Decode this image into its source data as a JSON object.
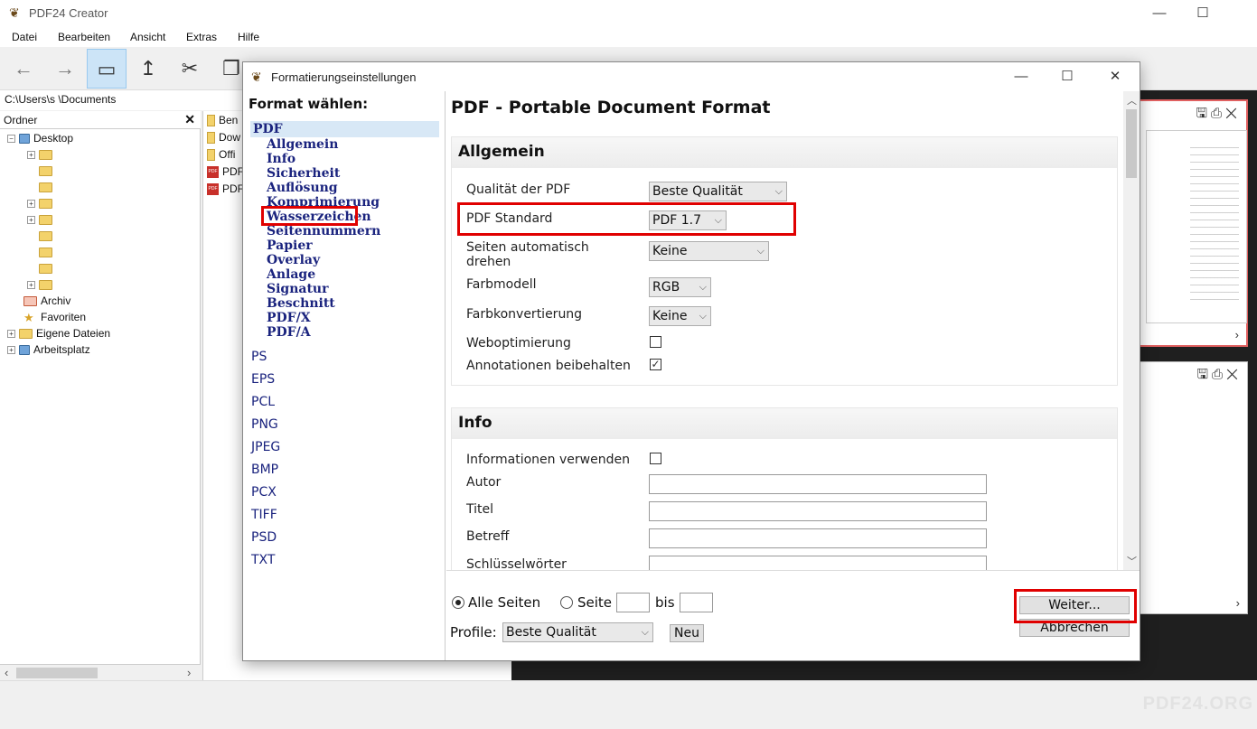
{
  "app": {
    "title": "PDF24 Creator",
    "brand": "PDF24.ORG",
    "menu": [
      "Datei",
      "Bearbeiten",
      "Ansicht",
      "Extras",
      "Hilfe"
    ]
  },
  "explorer": {
    "path": "C:\\Users\\s       \\Documents",
    "folder_header": "Ordner",
    "tree": [
      {
        "label": "Desktop"
      },
      {
        "label": ""
      },
      {
        "label": ""
      },
      {
        "label": ""
      },
      {
        "label": ""
      },
      {
        "label": ""
      },
      {
        "label": ""
      },
      {
        "label": ""
      },
      {
        "label": ""
      },
      {
        "label": ""
      },
      {
        "label": "Archiv"
      },
      {
        "label": "Favoriten"
      },
      {
        "label": "Eigene Dateien"
      },
      {
        "label": "Arbeitsplatz"
      }
    ],
    "files": [
      {
        "name": "Ben",
        "type": "folder"
      },
      {
        "name": "Dow",
        "type": "folder"
      },
      {
        "name": "Offi",
        "type": "folder"
      },
      {
        "name": "PDF",
        "type": "pdf"
      },
      {
        "name": "PDF",
        "type": "pdf"
      }
    ]
  },
  "dialog": {
    "title": "Formatierungseinstellungen",
    "nav_title": "Format wählen:",
    "selected_format": "PDF",
    "pdf_subitems": [
      "Allgemein",
      "Info",
      "Sicherheit",
      "Auflösung",
      "Komprimierung",
      "Wasserzeichen",
      "Seitennummern",
      "Papier",
      "Overlay",
      "Anlage",
      "Signatur",
      "Beschnitt",
      "PDF/X",
      "PDF/A"
    ],
    "other_formats": [
      "PS",
      "EPS",
      "PCL",
      "PNG",
      "JPEG",
      "BMP",
      "PCX",
      "TIFF",
      "PSD",
      "TXT"
    ],
    "content_title": "PDF - Portable Document Format",
    "allgemein": {
      "title": "Allgemein",
      "qualitaet_label": "Qualität der PDF",
      "qualitaet_value": "Beste Qualität",
      "standard_label": "PDF Standard",
      "standard_value": "PDF 1.7",
      "rotate_label_line1": "Seiten automatisch",
      "rotate_label_line2": "drehen",
      "rotate_value": "Keine",
      "farbmodell_label": "Farbmodell",
      "farbmodell_value": "RGB",
      "farbkonv_label": "Farbkonvertierung",
      "farbkonv_value": "Keine",
      "weboptimierung_label": "Weboptimierung",
      "weboptimierung_checked": false,
      "annotationen_label": "Annotationen beibehalten",
      "annotationen_checked": true
    },
    "info": {
      "title": "Info",
      "use_label": "Informationen verwenden",
      "use_checked": false,
      "autor_label": "Autor",
      "titel_label": "Titel",
      "betreff_label": "Betreff",
      "schluessel_label": "Schlüsselwörter"
    },
    "bottom": {
      "alle_seiten": "Alle Seiten",
      "seite": "Seite",
      "bis": "bis",
      "profile_label": "Profile:",
      "profile_value": "Beste Qualität",
      "neu": "Neu",
      "weiter": "Weiter...",
      "abbrechen": "Abbrechen"
    }
  },
  "icons": {
    "check": "✓",
    "chevron_down": "⌵",
    "close": "✕",
    "minimize": "—",
    "maximize": "☐"
  },
  "colors": {
    "highlight_red": "#e00000",
    "nav_text": "#1a237e",
    "selected_bg": "#d8e8f6"
  }
}
